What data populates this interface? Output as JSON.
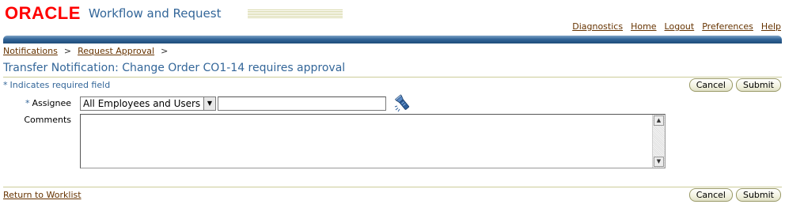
{
  "branding": {
    "logo_text": "ORACLE",
    "app_name": "Workflow and Request"
  },
  "global_links": [
    "Diagnostics",
    "Home",
    "Logout",
    "Preferences",
    "Help"
  ],
  "breadcrumb": {
    "items": [
      "Notifications",
      "Request Approval"
    ],
    "separator": ">"
  },
  "page_title": "Transfer Notification: Change Order CO1-14 requires approval",
  "required_indicator": {
    "star": "*",
    "text": "Indicates required field"
  },
  "buttons": {
    "cancel": "Cancel",
    "submit": "Submit"
  },
  "form": {
    "assignee": {
      "label": "Assignee",
      "required_star": "*",
      "selected_option": "All Employees and Users",
      "value": ""
    },
    "comments": {
      "label": "Comments",
      "value": ""
    }
  },
  "footer": {
    "return_link": "Return to Worklist"
  },
  "icons": {
    "search": "flashlight-icon",
    "dropdown": "chevron-down-icon"
  },
  "colors": {
    "brand_red": "#ff0000",
    "title_blue": "#336699",
    "link_brown": "#663300",
    "band_blue": "#336699",
    "rule_khaki": "#cccc99"
  }
}
